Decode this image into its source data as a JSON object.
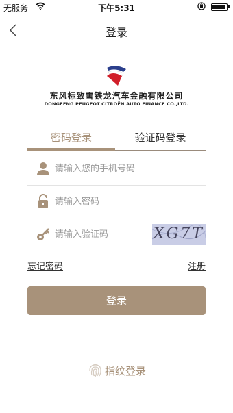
{
  "status_bar": {
    "carrier": "无服务",
    "time": "下午5:31"
  },
  "nav": {
    "title": "登录"
  },
  "brand": {
    "name_cn": "东风标致雪铁龙汽车金融有限公司",
    "name_en": "DONGFENG PEUGEOT CITROËN AUTO FINANCE CO.,LTD."
  },
  "tabs": [
    {
      "label": "密码登录",
      "active": true
    },
    {
      "label": "验证码登录",
      "active": false
    }
  ],
  "form": {
    "phone_placeholder": "请输入您的手机号码",
    "password_placeholder": "请输入密码",
    "captcha_placeholder": "请输入验证码",
    "captcha_text": "XG7T"
  },
  "links": {
    "forgot": "忘记密码",
    "register": "注册"
  },
  "login_button": "登录",
  "fingerprint_label": "指纹登录",
  "colors": {
    "accent": "#a8927a",
    "captcha_bg": "#c9cde6"
  }
}
